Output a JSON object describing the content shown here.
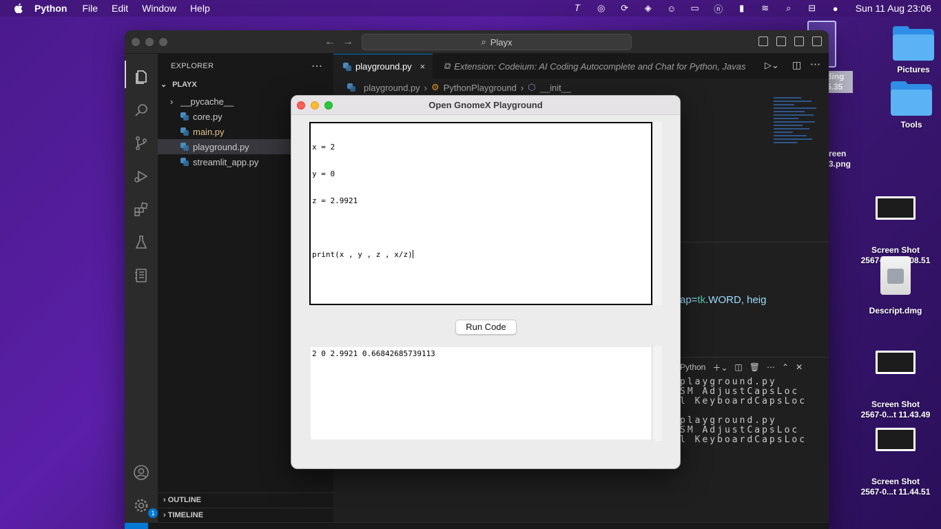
{
  "menubar": {
    "app_name": "Python",
    "items": [
      "File",
      "Edit",
      "Window",
      "Help"
    ],
    "clock": "Sun 11 Aug  23:06"
  },
  "desktop": {
    "icons": [
      {
        "label": "Pictures",
        "kind": "folder"
      },
      {
        "label": "Tools",
        "kind": "folder"
      },
      {
        "label": "Screen Shot\n2567-0...t 11.08.51",
        "kind": "screenshot"
      },
      {
        "label": "Descript.dmg",
        "kind": "disk-image"
      },
      {
        "label": "Screen Shot\n2567-0...t 11.43.49",
        "kind": "screenshot"
      },
      {
        "label": "Screen Shot\n2567-0...t 11.44.51",
        "kind": "screenshot"
      }
    ],
    "partial_labels": {
      "ding": "ding",
      "ding_sub": "5.35",
      "reen": "reen",
      "png": "3.png"
    }
  },
  "vscode": {
    "command_center": "Playx",
    "explorer_title": "EXPLORER",
    "folder_name": "PLAYX",
    "files": [
      {
        "name": "__pycache__",
        "type": "folder",
        "color": "#cccccc"
      },
      {
        "name": "core.py",
        "type": "py",
        "color": "#cccccc"
      },
      {
        "name": "main.py",
        "type": "py",
        "color": "#e2c08d"
      },
      {
        "name": "playground.py",
        "type": "py",
        "color": "#cccccc",
        "selected": true
      },
      {
        "name": "streamlit_app.py",
        "type": "py",
        "color": "#cccccc"
      }
    ],
    "outline_label": "OUTLINE",
    "timeline_label": "TIMELINE",
    "settings_badge": "1",
    "tabs": [
      {
        "label": "playground.py",
        "active": true
      },
      {
        "label": "Extension: Codeium: AI Coding Autocomplete and Chat for Python, Javas",
        "active": false
      }
    ],
    "breadcrumb": [
      "playground.py",
      "PythonPlayground",
      "__init__"
    ],
    "code_fragment_prefix": "ap=",
    "code_fragment_tk": "tk",
    "code_fragment_rest": ".WORD, heig",
    "panel_label": "Python",
    "panel_lines": [
      "playground.py",
      "SM AdjustCapsLoc",
      "l KeyboardCapsLoc",
      "",
      "playground.py",
      "SM AdjustCapsLoc",
      "l KeyboardCapsLoc"
    ]
  },
  "playground": {
    "title": "Open GnomeX Playground",
    "code_lines": [
      "x = 2",
      "y = 0",
      "z = 2.9921",
      "",
      "print(x , y , z , x/z)"
    ],
    "run_button": "Run Code",
    "output": "2 0 2.9921 0.66842685739113"
  }
}
